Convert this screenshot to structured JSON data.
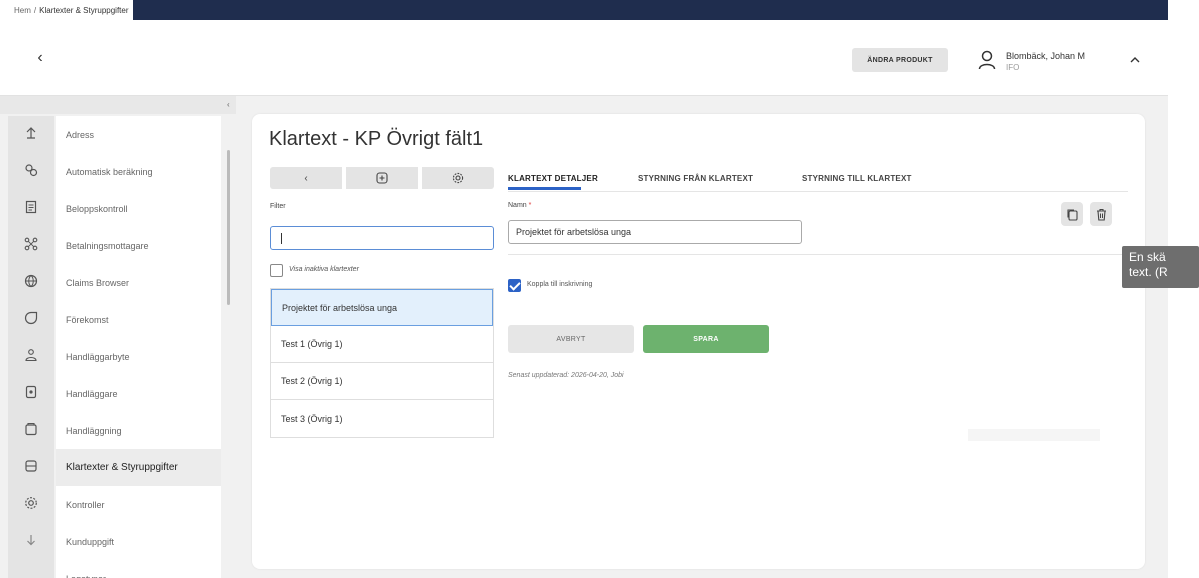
{
  "breadcrumb": {
    "home": "Hem",
    "separator": "/",
    "current": "Klartexter & Styruppgifter"
  },
  "header": {
    "back_symbol": "‹",
    "product_button": "ÄNDRA PRODUKT",
    "user_name": "Blombäck, Johan M",
    "user_role": "IFO",
    "chevron": "^"
  },
  "sidebar": {
    "collapse_symbol": "‹",
    "items": [
      {
        "label": "Adress",
        "icon": "upload-icon"
      },
      {
        "label": "Automatisk beräkning",
        "icon": "cogs-icon"
      },
      {
        "label": "Beloppskontroll",
        "icon": "document-icon"
      },
      {
        "label": "Betalningsmottagare",
        "icon": "nodes-icon"
      },
      {
        "label": "Claims Browser",
        "icon": "globe-icon"
      },
      {
        "label": "Förekomst",
        "icon": "circle-icon"
      },
      {
        "label": "Handläggarbyte",
        "icon": "users-icon"
      },
      {
        "label": "Handläggare",
        "icon": "file-icon"
      },
      {
        "label": "Handläggning",
        "icon": "box-icon"
      },
      {
        "label": "Klartexter & Styruppgifter",
        "icon": "database-icon"
      },
      {
        "label": "Kontroller",
        "icon": "settings-icon"
      },
      {
        "label": "Kunduppgift",
        "icon": "download-icon"
      },
      {
        "label": "Logotyper",
        "icon": ""
      }
    ]
  },
  "main": {
    "title": "Klartext - KP Övrigt fält1",
    "toolbar": {
      "back": "‹",
      "add_icon": "plus-square-icon",
      "settings_icon": "gear-icon"
    },
    "filter": {
      "label": "Filter",
      "value": ""
    },
    "show_inactive": {
      "label": "Visa inaktiva klartexter",
      "checked": false
    },
    "list": [
      {
        "label": "Projektet för arbetslösa unga",
        "selected": true
      },
      {
        "label": "Test 1 (Övrig 1)",
        "selected": false
      },
      {
        "label": "Test 2 (Övrig 1)",
        "selected": false
      },
      {
        "label": "Test 3 (Övrig 1)",
        "selected": false
      }
    ],
    "tabs": [
      "KLARTEXT DETALJER",
      "STYRNING FRÅN KLARTEXT",
      "STYRNING TILL KLARTEXT"
    ],
    "name": {
      "label": "Namn",
      "required_mark": "*",
      "value": "Projektet för arbetslösa unga"
    },
    "koppla": {
      "label": "Koppla till inskrivning",
      "checked": true
    },
    "cancel_label": "AVBRYT",
    "save_label": "SPARA",
    "updated_text": "Senast uppdaterad: 2026-04-20, Jobi"
  },
  "tooltip": {
    "line1": "En skä",
    "line2": "text. (R"
  },
  "colors": {
    "accent": "#2c62c6",
    "save": "#6db26e",
    "topbar": "#1f2d4e"
  }
}
